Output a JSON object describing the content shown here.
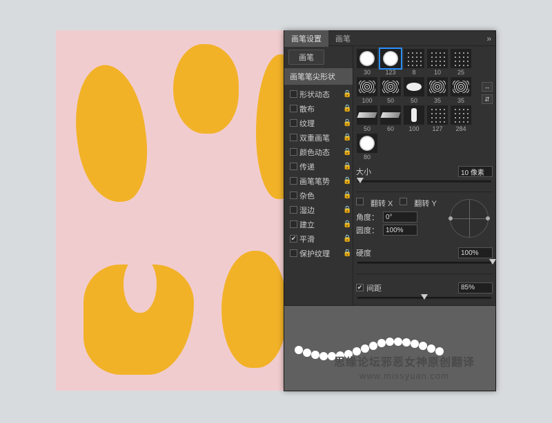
{
  "tabs": {
    "settings": "画笔设置",
    "brush": "画笔"
  },
  "left": {
    "brushBtn": "画笔",
    "header": "画笔笔尖形状",
    "opts": [
      {
        "label": "形状动态",
        "checked": false,
        "lock": true
      },
      {
        "label": "散布",
        "checked": false,
        "lock": true
      },
      {
        "label": "纹理",
        "checked": false,
        "lock": true
      },
      {
        "label": "双重画笔",
        "checked": false,
        "lock": true
      },
      {
        "label": "颜色动态",
        "checked": false,
        "lock": true
      },
      {
        "label": "传递",
        "checked": false,
        "lock": true
      },
      {
        "label": "画笔笔势",
        "checked": false,
        "lock": true
      },
      {
        "label": "杂色",
        "checked": false,
        "lock": true
      },
      {
        "label": "湿边",
        "checked": false,
        "lock": true
      },
      {
        "label": "建立",
        "checked": false,
        "lock": true
      },
      {
        "label": "平滑",
        "checked": true,
        "lock": true
      },
      {
        "label": "保护纹理",
        "checked": false,
        "lock": true
      }
    ]
  },
  "brushes": [
    {
      "label": "30",
      "type": "soft"
    },
    {
      "label": "123",
      "type": "soft",
      "selected": true
    },
    {
      "label": "8",
      "type": "scatter"
    },
    {
      "label": "10",
      "type": "scatter"
    },
    {
      "label": "25",
      "type": "scatter"
    },
    {
      "label": "100",
      "type": "rough"
    },
    {
      "label": "50",
      "type": "rough"
    },
    {
      "label": "50",
      "type": "oval"
    },
    {
      "label": "35",
      "type": "rough"
    },
    {
      "label": "35",
      "type": "rough"
    },
    {
      "label": "50",
      "type": "stroke"
    },
    {
      "label": "60",
      "type": "stroke"
    },
    {
      "label": "100",
      "type": "stick"
    },
    {
      "label": "127",
      "type": "scatter"
    },
    {
      "label": "284",
      "type": "scatter"
    },
    {
      "label": "80",
      "type": "soft"
    }
  ],
  "size": {
    "label": "大小",
    "value": "10 像素",
    "pct": 3
  },
  "flip": {
    "x": "翻转 X",
    "y": "翻转 Y",
    "cx": false,
    "cy": false
  },
  "angle": {
    "label": "角度：",
    "value": "0°"
  },
  "round": {
    "label": "圆度：",
    "value": "100%"
  },
  "hard": {
    "label": "硬度",
    "value": "100%",
    "pct": 100
  },
  "spacing": {
    "label": "间距",
    "value": "85%",
    "pct": 50,
    "checked": true
  },
  "watermark": {
    "line1": "思缘论坛邪恶女神原创翻译",
    "line2": "www.missyuan.com"
  }
}
